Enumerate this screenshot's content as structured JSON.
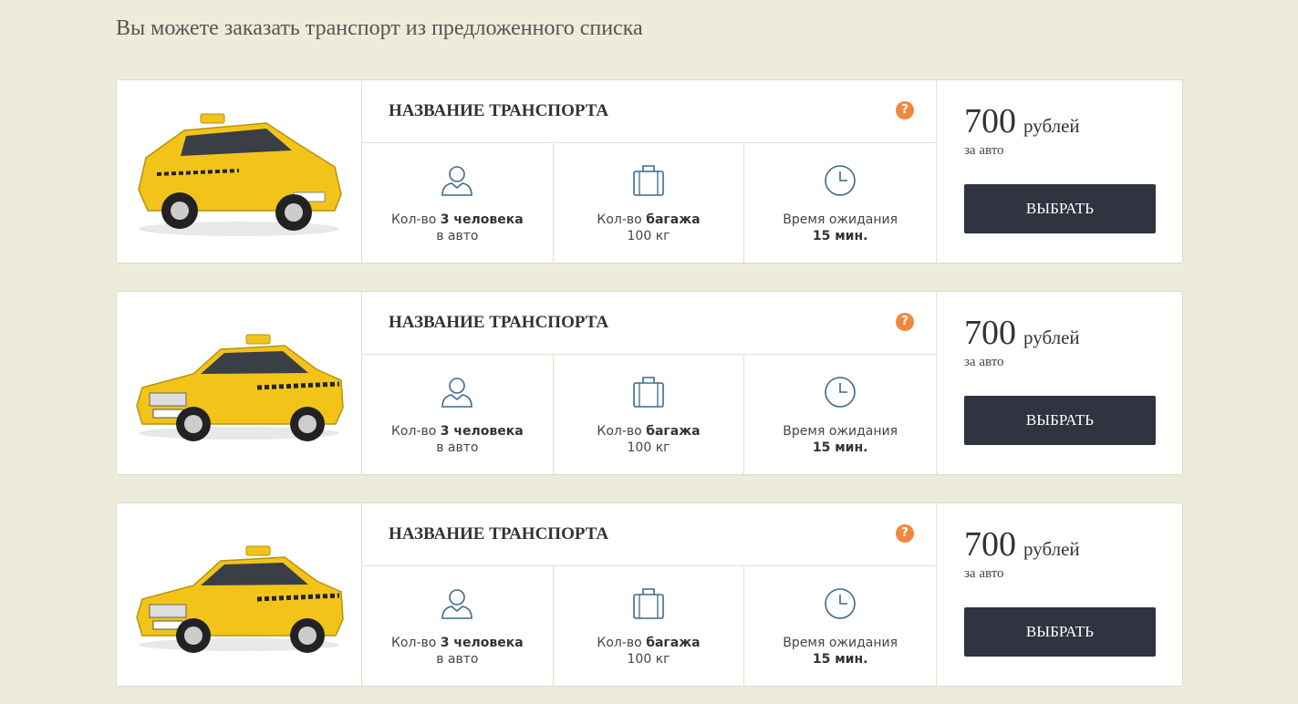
{
  "header": {
    "title": "Вы можете заказать транспорт из предложенного списка"
  },
  "colors": {
    "background": "#edecdb",
    "accent": "#f0883e",
    "button": "#303340",
    "taxi": "#f2c419"
  },
  "icons": {
    "help": "?",
    "person": "person-icon",
    "luggage": "luggage-icon",
    "clock": "clock-icon"
  },
  "cards": [
    {
      "name": "НАЗВАНИЕ ТРАНСПОРТА",
      "car_image": "hatchback-taxi-image",
      "features": {
        "people": {
          "prefix": "Кол-во ",
          "bold": "3 человека",
          "line2": "в авто"
        },
        "luggage": {
          "prefix": "Кол-во ",
          "bold": "багажа",
          "line2": "100 кг"
        },
        "wait": {
          "line1": "Время ожидания",
          "bold": "15 мин."
        }
      },
      "price": {
        "amount": "700",
        "unit": "рублей",
        "per": "за авто"
      },
      "button": "ВЫБРАТЬ"
    },
    {
      "name": "НАЗВАНИЕ ТРАНСПОРТА",
      "car_image": "sedan-taxi-image",
      "features": {
        "people": {
          "prefix": "Кол-во ",
          "bold": "3 человека",
          "line2": "в авто"
        },
        "luggage": {
          "prefix": "Кол-во ",
          "bold": "багажа",
          "line2": "100 кг"
        },
        "wait": {
          "line1": "Время ожидания",
          "bold": "15 мин."
        }
      },
      "price": {
        "amount": "700",
        "unit": "рублей",
        "per": "за авто"
      },
      "button": "ВЫБРАТЬ"
    },
    {
      "name": "НАЗВАНИЕ ТРАНСПОРТА",
      "car_image": "sedan-taxi-image",
      "features": {
        "people": {
          "prefix": "Кол-во ",
          "bold": "3 человека",
          "line2": "в авто"
        },
        "luggage": {
          "prefix": "Кол-во ",
          "bold": "багажа",
          "line2": "100 кг"
        },
        "wait": {
          "line1": "Время ожидания",
          "bold": "15 мин."
        }
      },
      "price": {
        "amount": "700",
        "unit": "рублей",
        "per": "за авто"
      },
      "button": "ВЫБРАТЬ"
    }
  ]
}
